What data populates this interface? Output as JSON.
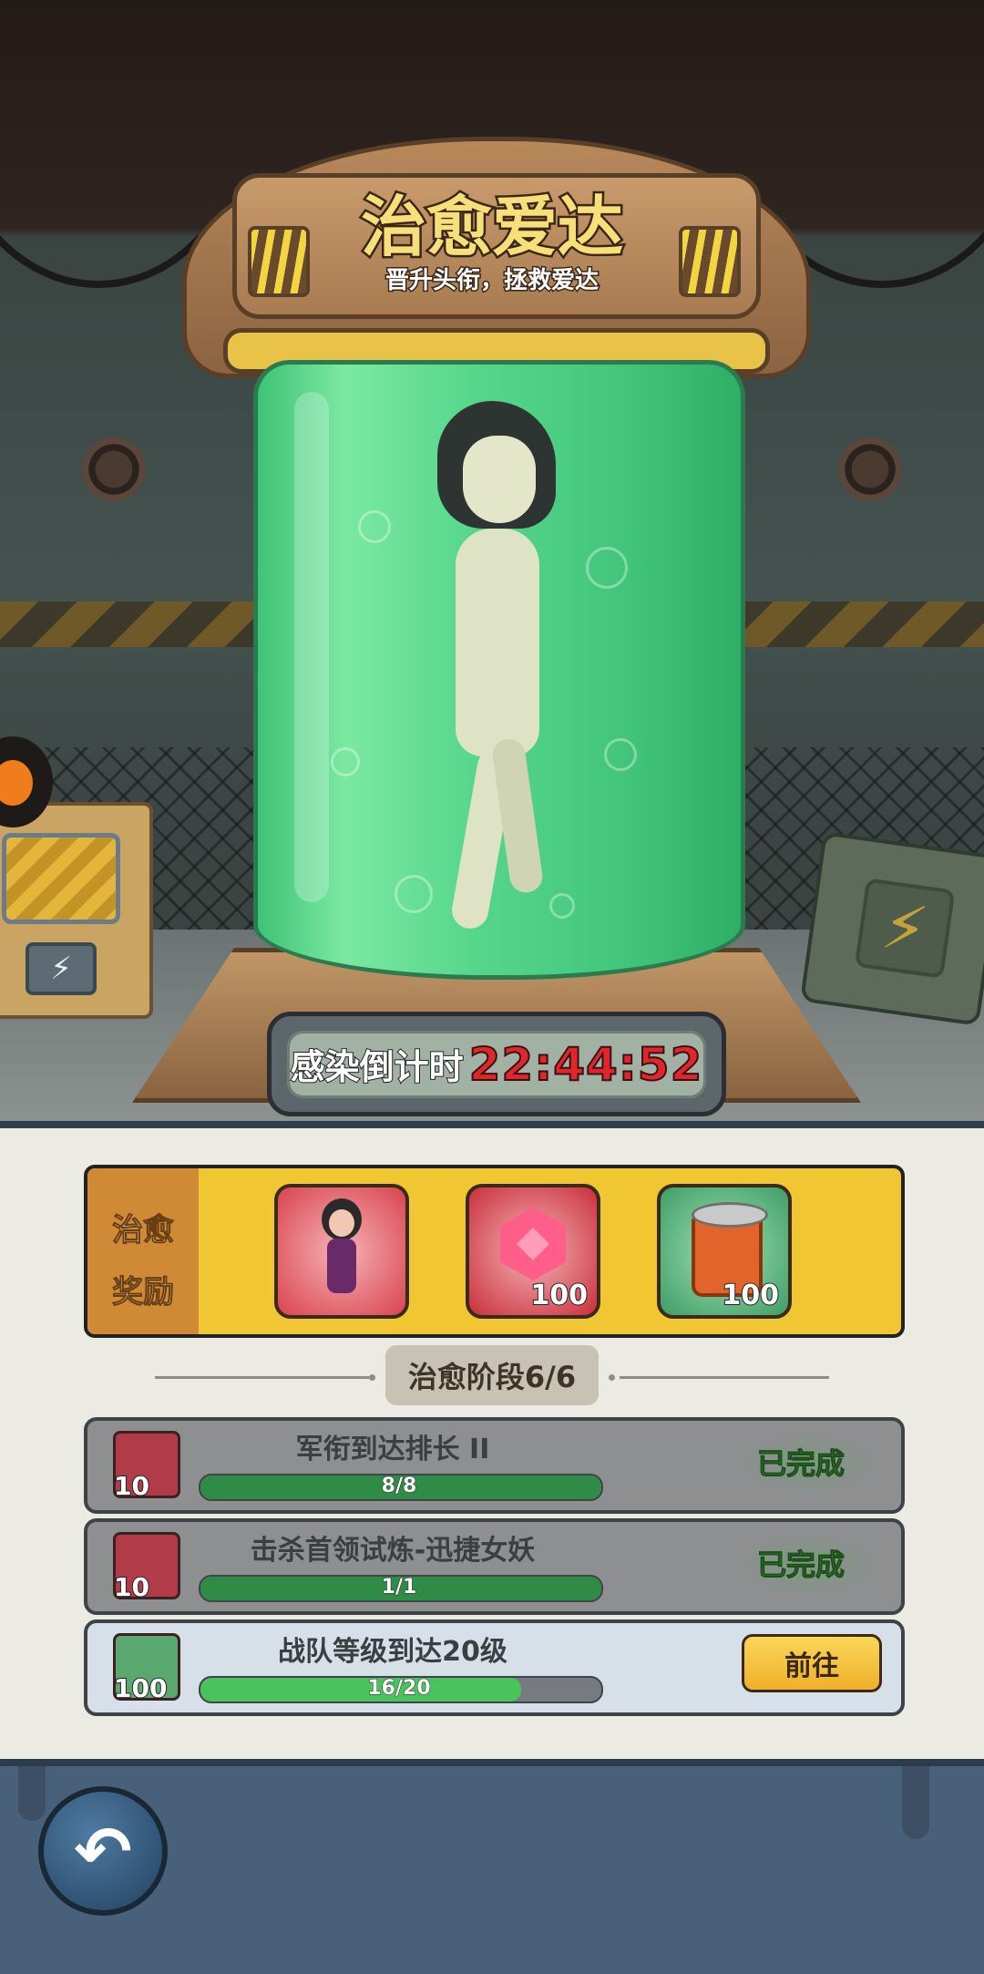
{
  "header": {
    "title": "治愈爱达",
    "subtitle": "晋升头衔，拯救爱达"
  },
  "countdown": {
    "label": "感染倒计时",
    "value": "22:44:52"
  },
  "reward": {
    "label_line1": "治愈",
    "label_line2": "奖励",
    "items": [
      {
        "icon": "hero-portrait-icon",
        "qty": ""
      },
      {
        "icon": "ruby-gem-icon",
        "qty": "100"
      },
      {
        "icon": "food-can-icon",
        "qty": "100"
      }
    ]
  },
  "stage": {
    "label": "治愈阶段6/6"
  },
  "tasks": [
    {
      "icon": "ruby-gem-icon",
      "qty": "10",
      "title": "军衔到达排长 II",
      "progress_text": "8/8",
      "progress": 1.0,
      "status": "已完成"
    },
    {
      "icon": "ruby-gem-icon",
      "qty": "10",
      "title": "击杀首领试炼-迅捷女妖",
      "progress_text": "1/1",
      "progress": 1.0,
      "status": "已完成"
    },
    {
      "icon": "food-can-icon",
      "qty": "100",
      "title": "战队等级到达20级",
      "progress_text": "16/20",
      "progress": 0.8,
      "button": "前往"
    }
  ],
  "colors": {
    "accent_yellow": "#f0c733",
    "timer_red": "#e0262d",
    "done_green": "#3d9c3a",
    "bottom_bar": "#49607a"
  }
}
